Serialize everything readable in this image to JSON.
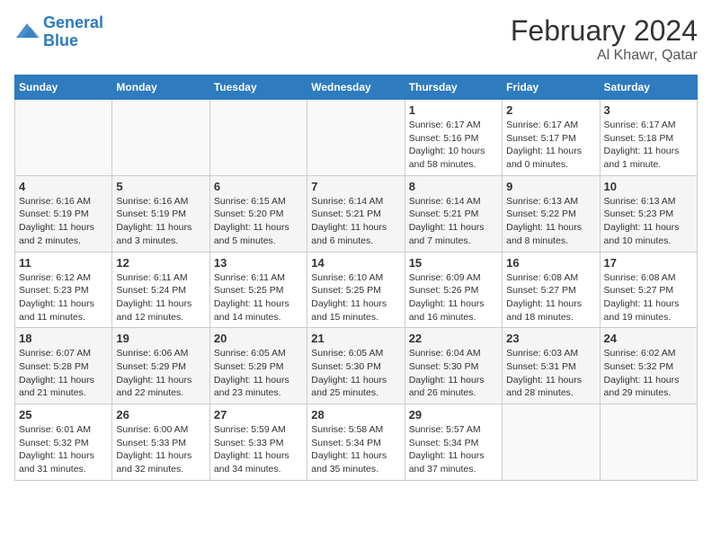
{
  "header": {
    "logo_line1": "General",
    "logo_line2": "Blue",
    "month": "February 2024",
    "location": "Al Khawr, Qatar"
  },
  "weekdays": [
    "Sunday",
    "Monday",
    "Tuesday",
    "Wednesday",
    "Thursday",
    "Friday",
    "Saturday"
  ],
  "weeks": [
    [
      {
        "day": "",
        "info": ""
      },
      {
        "day": "",
        "info": ""
      },
      {
        "day": "",
        "info": ""
      },
      {
        "day": "",
        "info": ""
      },
      {
        "day": "1",
        "info": "Sunrise: 6:17 AM\nSunset: 5:16 PM\nDaylight: 10 hours and 58 minutes."
      },
      {
        "day": "2",
        "info": "Sunrise: 6:17 AM\nSunset: 5:17 PM\nDaylight: 11 hours and 0 minutes."
      },
      {
        "day": "3",
        "info": "Sunrise: 6:17 AM\nSunset: 5:18 PM\nDaylight: 11 hours and 1 minute."
      }
    ],
    [
      {
        "day": "4",
        "info": "Sunrise: 6:16 AM\nSunset: 5:19 PM\nDaylight: 11 hours and 2 minutes."
      },
      {
        "day": "5",
        "info": "Sunrise: 6:16 AM\nSunset: 5:19 PM\nDaylight: 11 hours and 3 minutes."
      },
      {
        "day": "6",
        "info": "Sunrise: 6:15 AM\nSunset: 5:20 PM\nDaylight: 11 hours and 5 minutes."
      },
      {
        "day": "7",
        "info": "Sunrise: 6:14 AM\nSunset: 5:21 PM\nDaylight: 11 hours and 6 minutes."
      },
      {
        "day": "8",
        "info": "Sunrise: 6:14 AM\nSunset: 5:21 PM\nDaylight: 11 hours and 7 minutes."
      },
      {
        "day": "9",
        "info": "Sunrise: 6:13 AM\nSunset: 5:22 PM\nDaylight: 11 hours and 8 minutes."
      },
      {
        "day": "10",
        "info": "Sunrise: 6:13 AM\nSunset: 5:23 PM\nDaylight: 11 hours and 10 minutes."
      }
    ],
    [
      {
        "day": "11",
        "info": "Sunrise: 6:12 AM\nSunset: 5:23 PM\nDaylight: 11 hours and 11 minutes."
      },
      {
        "day": "12",
        "info": "Sunrise: 6:11 AM\nSunset: 5:24 PM\nDaylight: 11 hours and 12 minutes."
      },
      {
        "day": "13",
        "info": "Sunrise: 6:11 AM\nSunset: 5:25 PM\nDaylight: 11 hours and 14 minutes."
      },
      {
        "day": "14",
        "info": "Sunrise: 6:10 AM\nSunset: 5:25 PM\nDaylight: 11 hours and 15 minutes."
      },
      {
        "day": "15",
        "info": "Sunrise: 6:09 AM\nSunset: 5:26 PM\nDaylight: 11 hours and 16 minutes."
      },
      {
        "day": "16",
        "info": "Sunrise: 6:08 AM\nSunset: 5:27 PM\nDaylight: 11 hours and 18 minutes."
      },
      {
        "day": "17",
        "info": "Sunrise: 6:08 AM\nSunset: 5:27 PM\nDaylight: 11 hours and 19 minutes."
      }
    ],
    [
      {
        "day": "18",
        "info": "Sunrise: 6:07 AM\nSunset: 5:28 PM\nDaylight: 11 hours and 21 minutes."
      },
      {
        "day": "19",
        "info": "Sunrise: 6:06 AM\nSunset: 5:29 PM\nDaylight: 11 hours and 22 minutes."
      },
      {
        "day": "20",
        "info": "Sunrise: 6:05 AM\nSunset: 5:29 PM\nDaylight: 11 hours and 23 minutes."
      },
      {
        "day": "21",
        "info": "Sunrise: 6:05 AM\nSunset: 5:30 PM\nDaylight: 11 hours and 25 minutes."
      },
      {
        "day": "22",
        "info": "Sunrise: 6:04 AM\nSunset: 5:30 PM\nDaylight: 11 hours and 26 minutes."
      },
      {
        "day": "23",
        "info": "Sunrise: 6:03 AM\nSunset: 5:31 PM\nDaylight: 11 hours and 28 minutes."
      },
      {
        "day": "24",
        "info": "Sunrise: 6:02 AM\nSunset: 5:32 PM\nDaylight: 11 hours and 29 minutes."
      }
    ],
    [
      {
        "day": "25",
        "info": "Sunrise: 6:01 AM\nSunset: 5:32 PM\nDaylight: 11 hours and 31 minutes."
      },
      {
        "day": "26",
        "info": "Sunrise: 6:00 AM\nSunset: 5:33 PM\nDaylight: 11 hours and 32 minutes."
      },
      {
        "day": "27",
        "info": "Sunrise: 5:59 AM\nSunset: 5:33 PM\nDaylight: 11 hours and 34 minutes."
      },
      {
        "day": "28",
        "info": "Sunrise: 5:58 AM\nSunset: 5:34 PM\nDaylight: 11 hours and 35 minutes."
      },
      {
        "day": "29",
        "info": "Sunrise: 5:57 AM\nSunset: 5:34 PM\nDaylight: 11 hours and 37 minutes."
      },
      {
        "day": "",
        "info": ""
      },
      {
        "day": "",
        "info": ""
      }
    ]
  ]
}
